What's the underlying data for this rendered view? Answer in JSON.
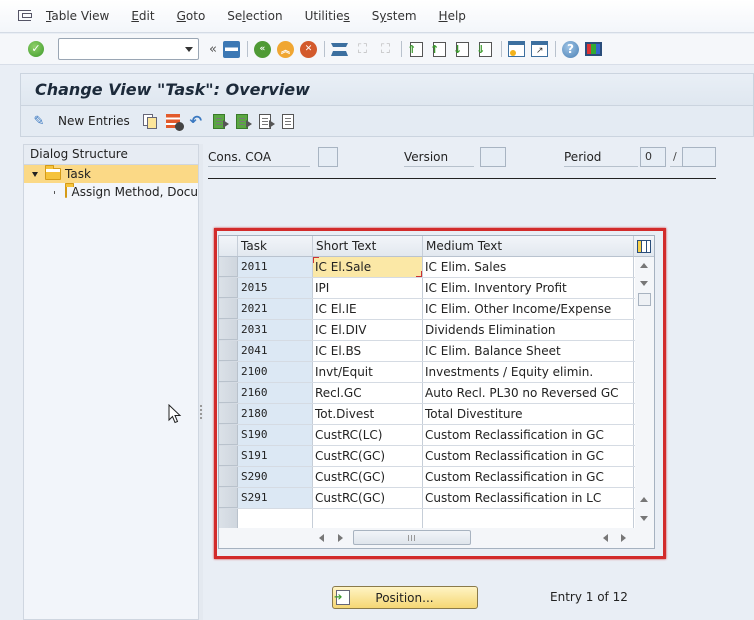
{
  "menubar": {
    "items": [
      {
        "label": "Table View",
        "accel": "T"
      },
      {
        "label": "Edit",
        "accel": "E"
      },
      {
        "label": "Goto",
        "accel": "G"
      },
      {
        "label": "Selection",
        "accel": "l"
      },
      {
        "label": "Utilities",
        "accel": "s"
      },
      {
        "label": "System",
        "accel": "y"
      },
      {
        "label": "Help",
        "accel": "H"
      }
    ]
  },
  "toolbar": {
    "command_field_value": "",
    "icons": [
      "enter-icon",
      "save-icon",
      "back-icon",
      "exit-icon",
      "cancel-icon",
      "print-icon",
      "find-icon",
      "find-next-icon",
      "first-page-icon",
      "previous-page-icon",
      "next-page-icon",
      "last-page-icon",
      "create-session-icon",
      "create-shortcut-icon",
      "help-icon",
      "customize-layout-icon"
    ]
  },
  "title": "Change View \"Task\": Overview",
  "app_toolbar": {
    "new_entries_label": "New Entries"
  },
  "dialog_structure": {
    "header": "Dialog Structure",
    "items": [
      {
        "label": "Task",
        "level": 0,
        "selected": true,
        "expanded": true
      },
      {
        "label": "Assign Method, Docu",
        "level": 1,
        "selected": false
      }
    ]
  },
  "header_fields": {
    "cons_coa": {
      "label": "Cons. COA",
      "value": ""
    },
    "version": {
      "label": "Version",
      "value": ""
    },
    "period": {
      "label": "Period",
      "value": "0",
      "separator": "/",
      "year": ""
    }
  },
  "table": {
    "columns": [
      "Task",
      "Short Text",
      "Medium Text"
    ],
    "rows": [
      {
        "task": "2011",
        "short": "IC El.Sale",
        "medium": "IC Elim. Sales"
      },
      {
        "task": "2015",
        "short": "IPI",
        "medium": "IC Elim. Inventory Profit"
      },
      {
        "task": "2021",
        "short": "IC El.IE",
        "medium": "IC Elim. Other Income/Expense"
      },
      {
        "task": "2031",
        "short": "IC El.DIV",
        "medium": "Dividends Elimination"
      },
      {
        "task": "2041",
        "short": "IC El.BS",
        "medium": "IC Elim. Balance Sheet"
      },
      {
        "task": "2100",
        "short": "Invt/Equit",
        "medium": "Investments / Equity elimin."
      },
      {
        "task": "2160",
        "short": "Recl.GC",
        "medium": "Auto Recl. PL30 no Reversed GC"
      },
      {
        "task": "2180",
        "short": "Tot.Divest",
        "medium": "Total Divestiture"
      },
      {
        "task": "S190",
        "short": "CustRC(LC)",
        "medium": "Custom Reclassification in GC"
      },
      {
        "task": "S191",
        "short": "CustRC(GC)",
        "medium": "Custom Reclassification in GC"
      },
      {
        "task": "S290",
        "short": "CustRC(GC)",
        "medium": "Custom Reclassification in GC"
      },
      {
        "task": "S291",
        "short": "CustRC(GC)",
        "medium": "Custom Reclassification in LC"
      },
      {
        "task": "",
        "short": "",
        "medium": ""
      }
    ]
  },
  "footer": {
    "position_button": "Position...",
    "entry_info": "Entry 1 of 12"
  },
  "colors": {
    "highlight_frame": "#d22b2b",
    "selected_tree_item": "#fbd986",
    "focused_cell": "#fbe8a6"
  }
}
